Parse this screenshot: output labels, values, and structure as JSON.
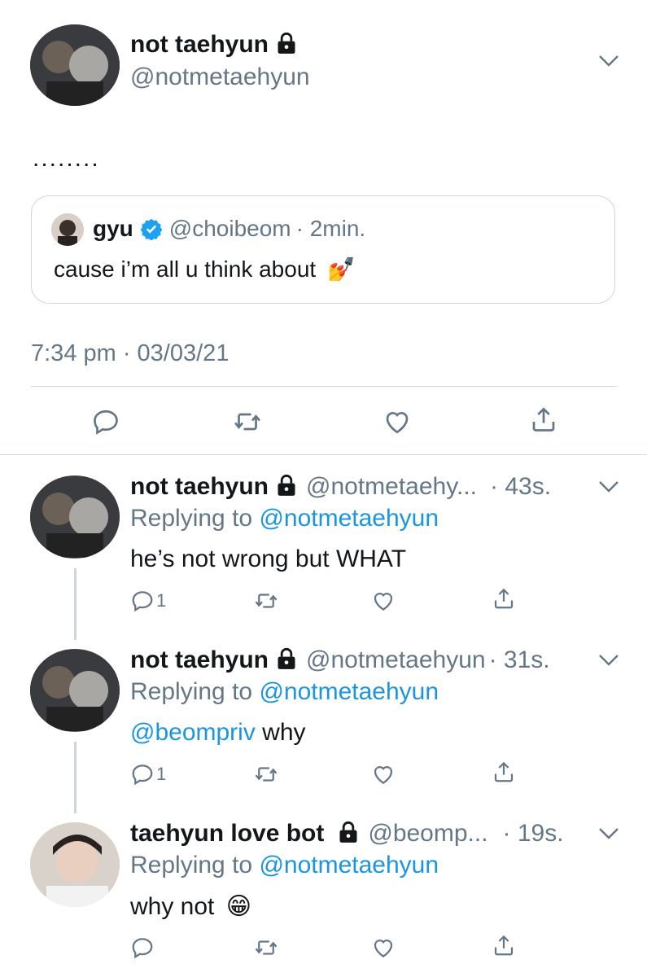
{
  "main_tweet": {
    "name": "not taehyun",
    "handle": "@notmetaehyun",
    "text": "........",
    "quote": {
      "name": "gyu",
      "handle": "@choibeom",
      "time": "· 2min.",
      "text": "cause i’m all u think about",
      "emoji": "💅"
    },
    "timestamp": "7:34 pm · 03/03/21"
  },
  "replies": [
    {
      "name": "not taehyun",
      "handle": "@notmetaehy...",
      "time": "· 43s.",
      "replying_label": "Replying to",
      "replying_to": "@notmetaehyun",
      "mention": "",
      "text": "he’s not wrong but WHAT",
      "reply_count": "1"
    },
    {
      "name": "not taehyun",
      "handle": "@notmetaehyun",
      "time": "· 31s.",
      "replying_label": "Replying to",
      "replying_to": "@notmetaehyun",
      "mention": "@beompriv",
      "text": " why",
      "reply_count": "1"
    },
    {
      "name": "taehyun love bot",
      "handle": "@beomp...",
      "time": "· 19s.",
      "replying_label": "Replying to",
      "replying_to": "@notmetaehyun",
      "mention": "",
      "text": "why not",
      "emoji": "😁",
      "reply_count": ""
    }
  ],
  "icons": [
    "lock-icon",
    "chevron-down-icon",
    "verified-icon",
    "reply-icon",
    "retweet-icon",
    "like-icon",
    "share-icon"
  ],
  "colors": {
    "link": "#1b95e0",
    "muted": "#657786",
    "divider": "#ccd6dd",
    "text": "#14171a"
  }
}
